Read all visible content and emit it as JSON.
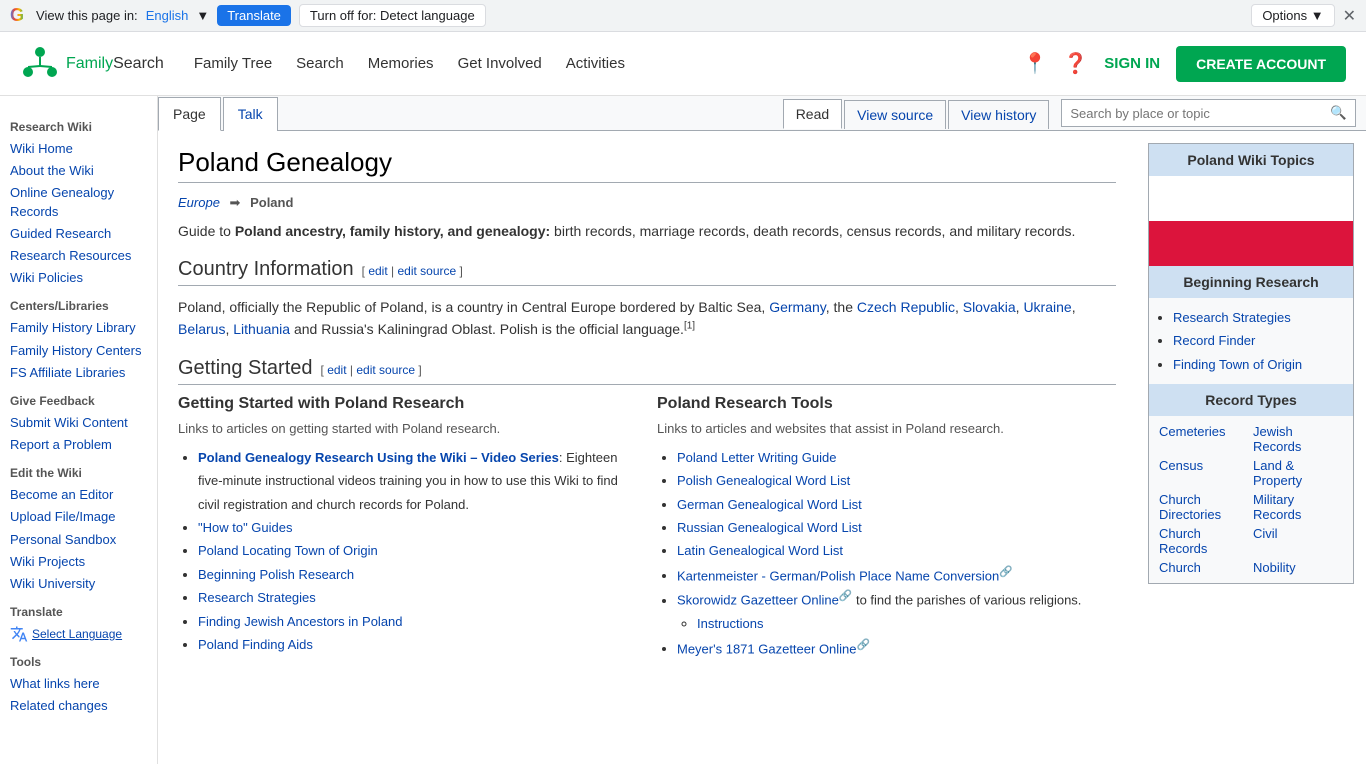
{
  "translate_bar": {
    "view_text": "View this page in:",
    "language": "English",
    "translate_label": "Translate",
    "turn_off_label": "Turn off for: Detect language",
    "options_label": "Options ▼"
  },
  "header": {
    "logo_text_green": "Family",
    "logo_text_dark": "Search",
    "nav": [
      {
        "label": "Family Tree",
        "href": "#"
      },
      {
        "label": "Search",
        "href": "#"
      },
      {
        "label": "Memories",
        "href": "#"
      },
      {
        "label": "Get Involved",
        "href": "#"
      },
      {
        "label": "Activities",
        "href": "#"
      }
    ],
    "sign_in_label": "SIGN IN",
    "create_account_label": "CREATE ACCOUNT"
  },
  "sidebar": {
    "research_wiki_title": "Research Wiki",
    "items_research": [
      {
        "label": "Wiki Home",
        "href": "#"
      },
      {
        "label": "About the Wiki",
        "href": "#"
      },
      {
        "label": "Online Genealogy Records",
        "href": "#"
      },
      {
        "label": "Guided Research",
        "href": "#"
      },
      {
        "label": "Research Resources",
        "href": "#"
      },
      {
        "label": "Wiki Policies",
        "href": "#"
      }
    ],
    "centers_title": "Centers/Libraries",
    "items_centers": [
      {
        "label": "Family History Library",
        "href": "#"
      },
      {
        "label": "Family History Centers",
        "href": "#"
      },
      {
        "label": "FS Affiliate Libraries",
        "href": "#"
      }
    ],
    "feedback_title": "Give Feedback",
    "items_feedback": [
      {
        "label": "Submit Wiki Content",
        "href": "#"
      },
      {
        "label": "Report a Problem",
        "href": "#"
      }
    ],
    "edit_wiki_title": "Edit the Wiki",
    "items_edit": [
      {
        "label": "Become an Editor",
        "href": "#"
      },
      {
        "label": "Upload File/Image",
        "href": "#"
      },
      {
        "label": "Personal Sandbox",
        "href": "#"
      },
      {
        "label": "Wiki Projects",
        "href": "#"
      },
      {
        "label": "Wiki University",
        "href": "#"
      }
    ],
    "translate_title": "Translate",
    "tools_title": "Tools",
    "tools_items": [
      {
        "label": "What links here",
        "href": "#"
      },
      {
        "label": "Related changes",
        "href": "#"
      }
    ]
  },
  "page_tabs": {
    "tab_page": "Page",
    "tab_talk": "Talk",
    "action_read": "Read",
    "action_view_source": "View source",
    "action_view_history": "View history",
    "search_placeholder": "Search by place or topic"
  },
  "article": {
    "title": "Poland Genealogy",
    "breadcrumb_europe": "Europe",
    "breadcrumb_poland": "Poland",
    "intro": "Guide to <strong>Poland ancestry, family history, and genealogy:</strong> birth records, marriage records, death records, census records, and military records.",
    "country_section": {
      "title": "Country Information",
      "edit": "edit",
      "edit_source": "edit source",
      "body": "Poland, officially the Republic of Poland, is a country in Central Europe bordered by Baltic Sea, <a href='#'>Germany</a>, the <a href='#'>Czech Republic</a>, <a href='#'>Slovakia</a>, <a href='#'>Ukraine</a>, <a href='#'>Belarus</a>, <a href='#'>Lithuania</a> and Russia's Kaliningrad Oblast. Polish is the official language.<sup>[1]</sup>"
    },
    "getting_started_section": {
      "title": "Getting Started",
      "edit": "edit",
      "edit_source": "edit source"
    },
    "left_col": {
      "title": "Getting Started with Poland Research",
      "desc": "Links to articles on getting started with Poland research.",
      "items": [
        {
          "text": "Poland Genealogy Research Using the Wiki – Video Series",
          "bold": true,
          "suffix": ": Eighteen five-minute instructional videos training you in how to use this Wiki to find civil registration and church records for Poland.",
          "href": "#"
        },
        {
          "text": "\"How to\" Guides",
          "href": "#"
        },
        {
          "text": "Poland Locating Town of Origin",
          "href": "#"
        },
        {
          "text": "Beginning Polish Research",
          "href": "#"
        },
        {
          "text": "Research Strategies",
          "href": "#"
        },
        {
          "text": "Finding Jewish Ancestors in Poland",
          "href": "#"
        },
        {
          "text": "Poland Finding Aids",
          "href": "#"
        }
      ]
    },
    "right_col": {
      "title": "Poland Research Tools",
      "desc": "Links to articles and websites that assist in Poland research.",
      "items": [
        {
          "text": "Poland Letter Writing Guide",
          "href": "#"
        },
        {
          "text": "Polish Genealogical Word List",
          "href": "#"
        },
        {
          "text": "German Genealogical Word List",
          "href": "#"
        },
        {
          "text": "Russian Genealogical Word List",
          "href": "#"
        },
        {
          "text": "Latin Genealogical Word List",
          "href": "#"
        },
        {
          "text": "Kartenmeister - German/Polish Place Name Conversion",
          "href": "#",
          "external": true
        },
        {
          "text": "Skorowidz Gazetteer Online",
          "href": "#",
          "external": true,
          "suffix": " to find the parishes of various religions.",
          "sub": [
            "Instructions"
          ]
        },
        {
          "text": "Meyer's 1871 Gazetteer Online",
          "href": "#",
          "external": true
        }
      ]
    }
  },
  "right_sidebar": {
    "topics_title": "Poland Wiki Topics",
    "beginning_title": "Beginning Research",
    "beginning_links": [
      {
        "label": "Research Strategies"
      },
      {
        "label": "Record Finder"
      },
      {
        "label": "Finding Town of Origin"
      }
    ],
    "record_types_title": "Record Types",
    "record_types": [
      {
        "label": "Cemeteries"
      },
      {
        "label": "Jewish Records"
      },
      {
        "label": "Census"
      },
      {
        "label": "Land & Property"
      },
      {
        "label": "Church Directories"
      },
      {
        "label": "Military Records"
      },
      {
        "label": "Church Records"
      },
      {
        "label": "Civil"
      },
      {
        "label": "Nobility"
      }
    ]
  },
  "colors": {
    "link": "#0645ad",
    "green": "#00a651",
    "header_bg": "#cee0f2",
    "flag_red": "#dc143c"
  }
}
